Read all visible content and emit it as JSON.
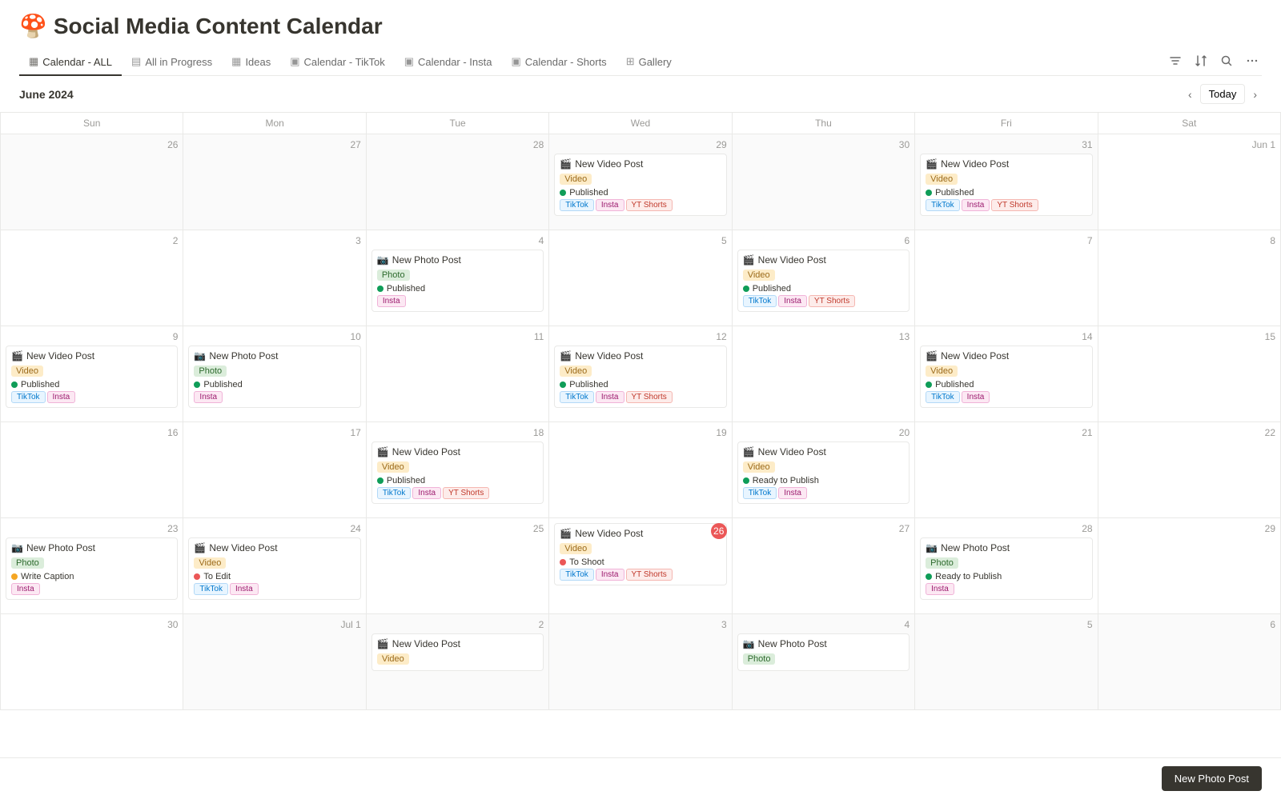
{
  "app": {
    "title": "Social Media Content Calendar",
    "emoji": "🍄"
  },
  "nav": {
    "tabs": [
      {
        "id": "calendar-all",
        "label": "Calendar - ALL",
        "icon": "▦",
        "active": true
      },
      {
        "id": "all-in-progress",
        "label": "All in Progress",
        "icon": "▤"
      },
      {
        "id": "ideas",
        "label": "Ideas",
        "icon": "▦"
      },
      {
        "id": "calendar-tiktok",
        "label": "Calendar - TikTok",
        "icon": "▣"
      },
      {
        "id": "calendar-insta",
        "label": "Calendar - Insta",
        "icon": "▣"
      },
      {
        "id": "calendar-shorts",
        "label": "Calendar - Shorts",
        "icon": "▣"
      },
      {
        "id": "gallery",
        "label": "Gallery",
        "icon": "⊞"
      }
    ]
  },
  "calendar": {
    "month_label": "June 2024",
    "today_label": "Today",
    "day_headers": [
      "Sun",
      "Mon",
      "Tue",
      "Wed",
      "Thu",
      "Fri",
      "Sat"
    ]
  },
  "weeks": [
    {
      "days": [
        {
          "num": "26",
          "outside": true,
          "cards": []
        },
        {
          "num": "27",
          "outside": true,
          "cards": []
        },
        {
          "num": "28",
          "outside": true,
          "cards": []
        },
        {
          "num": "29",
          "outside": true,
          "cards": [
            {
              "title": "New Video Post",
              "emoji": "🎬",
              "type_tag": "Video",
              "type_class": "tag-video",
              "status_label": "Published",
              "status_class": "dot-published",
              "platforms": [
                {
                  "l": "TikTok",
                  "c": "ptag-tiktok"
                },
                {
                  "l": "Insta",
                  "c": "ptag-insta"
                },
                {
                  "l": "YT Shorts",
                  "c": "ptag-ytshorts"
                }
              ]
            }
          ]
        },
        {
          "num": "30",
          "outside": true,
          "cards": []
        },
        {
          "num": "31",
          "outside": true,
          "cards": [
            {
              "title": "New Video Post",
              "emoji": "🎬",
              "type_tag": "Video",
              "type_class": "tag-video",
              "status_label": "Published",
              "status_class": "dot-published",
              "platforms": [
                {
                  "l": "TikTok",
                  "c": "ptag-tiktok"
                },
                {
                  "l": "Insta",
                  "c": "ptag-insta"
                },
                {
                  "l": "YT Shorts",
                  "c": "ptag-ytshorts"
                }
              ]
            }
          ]
        },
        {
          "num": "Jun 1",
          "outside": false,
          "cards": []
        }
      ]
    },
    {
      "days": [
        {
          "num": "2",
          "outside": false,
          "cards": []
        },
        {
          "num": "3",
          "outside": false,
          "cards": []
        },
        {
          "num": "4",
          "outside": false,
          "cards": [
            {
              "title": "New Photo Post",
              "emoji": "📷",
              "type_tag": "Photo",
              "type_class": "tag-photo",
              "status_label": "Published",
              "status_class": "dot-published",
              "platforms": [
                {
                  "l": "Insta",
                  "c": "ptag-insta"
                }
              ]
            }
          ]
        },
        {
          "num": "5",
          "outside": false,
          "cards": []
        },
        {
          "num": "6",
          "outside": false,
          "cards": [
            {
              "title": "New Video Post",
              "emoji": "🎬",
              "type_tag": "Video",
              "type_class": "tag-video",
              "status_label": "Published",
              "status_class": "dot-published",
              "platforms": [
                {
                  "l": "TikTok",
                  "c": "ptag-tiktok"
                },
                {
                  "l": "Insta",
                  "c": "ptag-insta"
                },
                {
                  "l": "YT Shorts",
                  "c": "ptag-ytshorts"
                }
              ]
            }
          ]
        },
        {
          "num": "7",
          "outside": false,
          "cards": []
        },
        {
          "num": "8",
          "outside": false,
          "cards": []
        }
      ]
    },
    {
      "days": [
        {
          "num": "9",
          "outside": false,
          "cards": [
            {
              "title": "New Video Post",
              "emoji": "🎬",
              "type_tag": "Video",
              "type_class": "tag-video",
              "status_label": "Published",
              "status_class": "dot-published",
              "platforms": [
                {
                  "l": "TikTok",
                  "c": "ptag-tiktok"
                },
                {
                  "l": "Insta",
                  "c": "ptag-insta"
                }
              ]
            }
          ]
        },
        {
          "num": "10",
          "outside": false,
          "cards": [
            {
              "title": "New Photo Post",
              "emoji": "📷",
              "type_tag": "Photo",
              "type_class": "tag-photo",
              "status_label": "Published",
              "status_class": "dot-published",
              "platforms": [
                {
                  "l": "Insta",
                  "c": "ptag-insta"
                }
              ]
            }
          ]
        },
        {
          "num": "11",
          "outside": false,
          "cards": []
        },
        {
          "num": "12",
          "outside": false,
          "cards": [
            {
              "title": "New Video Post",
              "emoji": "🎬",
              "type_tag": "Video",
              "type_class": "tag-video",
              "status_label": "Published",
              "status_class": "dot-published",
              "platforms": [
                {
                  "l": "TikTok",
                  "c": "ptag-tiktok"
                },
                {
                  "l": "Insta",
                  "c": "ptag-insta"
                },
                {
                  "l": "YT Shorts",
                  "c": "ptag-ytshorts"
                }
              ]
            }
          ]
        },
        {
          "num": "13",
          "outside": false,
          "cards": []
        },
        {
          "num": "14",
          "outside": false,
          "cards": [
            {
              "title": "New Video Post",
              "emoji": "🎬",
              "type_tag": "Video",
              "type_class": "tag-video",
              "status_label": "Published",
              "status_class": "dot-published",
              "platforms": [
                {
                  "l": "TikTok",
                  "c": "ptag-tiktok"
                },
                {
                  "l": "Insta",
                  "c": "ptag-insta"
                }
              ]
            }
          ]
        },
        {
          "num": "15",
          "outside": false,
          "cards": []
        }
      ]
    },
    {
      "days": [
        {
          "num": "16",
          "outside": false,
          "cards": []
        },
        {
          "num": "17",
          "outside": false,
          "cards": []
        },
        {
          "num": "18",
          "outside": false,
          "cards": [
            {
              "title": "New Video Post",
              "emoji": "🎬",
              "type_tag": "Video",
              "type_class": "tag-video",
              "status_label": "Published",
              "status_class": "dot-published",
              "platforms": [
                {
                  "l": "TikTok",
                  "c": "ptag-tiktok"
                },
                {
                  "l": "Insta",
                  "c": "ptag-insta"
                },
                {
                  "l": "YT Shorts",
                  "c": "ptag-ytshorts"
                }
              ]
            }
          ]
        },
        {
          "num": "19",
          "outside": false,
          "cards": []
        },
        {
          "num": "20",
          "outside": false,
          "cards": [
            {
              "title": "New Video Post",
              "emoji": "🎬",
              "type_tag": "Video",
              "type_class": "tag-video",
              "status_label": "Ready to Publish",
              "status_class": "dot-ready",
              "platforms": [
                {
                  "l": "TikTok",
                  "c": "ptag-tiktok"
                },
                {
                  "l": "Insta",
                  "c": "ptag-insta"
                }
              ]
            }
          ]
        },
        {
          "num": "21",
          "outside": false,
          "cards": []
        },
        {
          "num": "22",
          "outside": false,
          "cards": []
        }
      ]
    },
    {
      "days": [
        {
          "num": "23",
          "outside": false,
          "cards": [
            {
              "title": "New Photo Post",
              "emoji": "📷",
              "type_tag": "Photo",
              "type_class": "tag-photo",
              "status_label": "Write Caption",
              "status_class": "dot-write-caption",
              "platforms": [
                {
                  "l": "Insta",
                  "c": "ptag-insta"
                }
              ]
            }
          ]
        },
        {
          "num": "24",
          "outside": false,
          "cards": [
            {
              "title": "New Video Post",
              "emoji": "🎬",
              "type_tag": "Video",
              "type_class": "tag-video",
              "status_label": "To Edit",
              "status_class": "dot-to-edit",
              "platforms": [
                {
                  "l": "TikTok",
                  "c": "ptag-tiktok"
                },
                {
                  "l": "Insta",
                  "c": "ptag-insta"
                }
              ]
            }
          ]
        },
        {
          "num": "25",
          "outside": false,
          "cards": []
        },
        {
          "num": "26",
          "outside": false,
          "today": true,
          "cards": [
            {
              "title": "New Video Post",
              "emoji": "🎬",
              "type_tag": "Video",
              "type_class": "tag-video",
              "status_label": "To Shoot",
              "status_class": "dot-to-shoot",
              "platforms": [
                {
                  "l": "TikTok",
                  "c": "ptag-tiktok"
                },
                {
                  "l": "Insta",
                  "c": "ptag-insta"
                },
                {
                  "l": "YT Shorts",
                  "c": "ptag-ytshorts"
                }
              ]
            }
          ]
        },
        {
          "num": "27",
          "outside": false,
          "cards": []
        },
        {
          "num": "28",
          "outside": false,
          "cards": [
            {
              "title": "New Photo Post",
              "emoji": "📷",
              "type_tag": "Photo",
              "type_class": "tag-photo",
              "status_label": "Ready to Publish",
              "status_class": "dot-ready",
              "platforms": [
                {
                  "l": "Insta",
                  "c": "ptag-insta"
                }
              ]
            }
          ]
        },
        {
          "num": "29",
          "outside": false,
          "cards": []
        }
      ]
    },
    {
      "days": [
        {
          "num": "30",
          "outside": false,
          "cards": []
        },
        {
          "num": "Jul 1",
          "outside": true,
          "cards": []
        },
        {
          "num": "2",
          "outside": true,
          "cards": [
            {
              "title": "New Video Post",
              "emoji": "🎬",
              "type_tag": "Video",
              "type_class": "tag-video",
              "status_label": "",
              "status_class": "",
              "platforms": []
            }
          ]
        },
        {
          "num": "3",
          "outside": true,
          "cards": []
        },
        {
          "num": "4",
          "outside": true,
          "cards": [
            {
              "title": "New Photo Post",
              "emoji": "📷",
              "type_tag": "Photo",
              "type_class": "tag-photo",
              "status_label": "",
              "status_class": "",
              "platforms": []
            }
          ]
        },
        {
          "num": "5",
          "outside": true,
          "cards": []
        },
        {
          "num": "6",
          "outside": true,
          "cards": []
        }
      ]
    }
  ],
  "footer": {
    "new_post_label": "New Photo Post"
  }
}
